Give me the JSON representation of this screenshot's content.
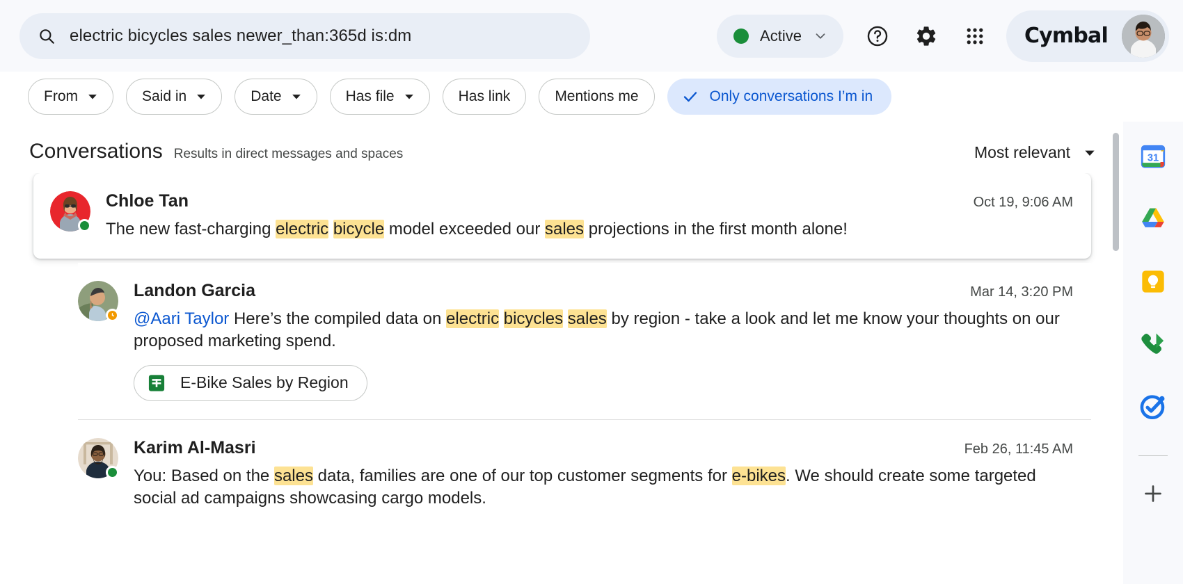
{
  "topbar": {
    "search": {
      "icon": "search-icon",
      "value": "electric bicycles sales newer_than:365d is:dm",
      "placeholder": "Search"
    },
    "status": {
      "label": "Active",
      "dot_color": "#1a8e3a",
      "caret": "chevron-down-icon"
    },
    "help_icon": "help-circle-icon",
    "settings_icon": "gear-icon",
    "apps_icon": "apps-grid-icon",
    "brand": {
      "name": "Cymbal",
      "avatar": "user-avatar"
    }
  },
  "filters": {
    "chips": [
      {
        "label": "From",
        "has_caret": true,
        "active": false
      },
      {
        "label": "Said in",
        "has_caret": true,
        "active": false
      },
      {
        "label": "Date",
        "has_caret": true,
        "active": false
      },
      {
        "label": "Has file",
        "has_caret": true,
        "active": false
      },
      {
        "label": "Has link",
        "has_caret": false,
        "active": false
      },
      {
        "label": "Mentions me",
        "has_caret": false,
        "active": false
      },
      {
        "label": "Only conversations I’m in",
        "has_caret": false,
        "active": true
      }
    ],
    "active_color": "#0b57d0",
    "active_bg": "#dce8fd"
  },
  "results": {
    "title": "Conversations",
    "subtitle": "Results in direct messages and spaces",
    "sort": {
      "label": "Most relevant",
      "caret": "caret-down-icon"
    },
    "items": [
      {
        "sender": "Chloe Tan",
        "timestamp": "Oct 19, 9:06 AM",
        "presence": "online",
        "avatar_bg": "#e8262c",
        "snippet_parts": [
          {
            "text": "The new fast-charging ",
            "type": "plain"
          },
          {
            "text": "electric",
            "type": "highlight"
          },
          {
            "text": " ",
            "type": "plain"
          },
          {
            "text": "bicycle",
            "type": "highlight"
          },
          {
            "text": " model exceeded our ",
            "type": "plain"
          },
          {
            "text": "sales",
            "type": "highlight"
          },
          {
            "text": " projections in the first month alone!",
            "type": "plain"
          }
        ],
        "attachment": null,
        "elevated": true
      },
      {
        "sender": "Landon Garcia",
        "timestamp": "Mar 14, 3:20 PM",
        "presence": "away",
        "avatar_bg": "#7d8a6a",
        "snippet_parts": [
          {
            "text": "@Aari Taylor",
            "type": "mention"
          },
          {
            "text": " Here’s the compiled data on ",
            "type": "plain"
          },
          {
            "text": "electric",
            "type": "highlight"
          },
          {
            "text": " ",
            "type": "plain"
          },
          {
            "text": "bicycles",
            "type": "highlight"
          },
          {
            "text": " ",
            "type": "plain"
          },
          {
            "text": "sales",
            "type": "highlight"
          },
          {
            "text": " by region - take a look and let me know your thoughts on our proposed marketing spend.",
            "type": "plain"
          }
        ],
        "attachment": {
          "label": "E-Bike Sales by Region",
          "icon": "google-sheets-icon"
        },
        "elevated": false
      },
      {
        "sender": "Karim Al-Masri",
        "timestamp": "Feb 26, 11:45 AM",
        "presence": "online",
        "avatar_bg": "#d9cdbf",
        "snippet_parts": [
          {
            "text": "You: Based on the ",
            "type": "plain"
          },
          {
            "text": "sales",
            "type": "highlight"
          },
          {
            "text": " data, families are one of our top customer segments for ",
            "type": "plain"
          },
          {
            "text": "e-bikes",
            "type": "highlight"
          },
          {
            "text": ". We should create some targeted social ad campaigns showcasing cargo models.",
            "type": "plain"
          }
        ],
        "attachment": null,
        "elevated": false
      }
    ],
    "highlight_color": "#fde293",
    "mention_color": "#0b57d0"
  },
  "right_rail": {
    "items": [
      {
        "name": "google-calendar-icon",
        "label": "31"
      },
      {
        "name": "google-drive-icon",
        "label": ""
      },
      {
        "name": "google-keep-icon",
        "label": ""
      },
      {
        "name": "google-voice-icon",
        "label": ""
      },
      {
        "name": "google-tasks-icon",
        "label": ""
      }
    ],
    "add_label": "+"
  }
}
